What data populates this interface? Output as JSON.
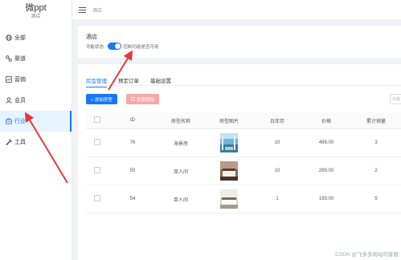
{
  "sidebar": {
    "title": "微ppt",
    "subtitle": "酒店",
    "items": [
      {
        "label": "全部",
        "icon": "globe-icon"
      },
      {
        "label": "渠道",
        "icon": "channel-icon"
      },
      {
        "label": "营销",
        "icon": "chart-icon"
      },
      {
        "label": "会员",
        "icon": "user-icon"
      },
      {
        "label": "行业",
        "icon": "briefcase-icon",
        "active": true
      },
      {
        "label": "工具",
        "icon": "tool-icon"
      }
    ]
  },
  "header": {
    "breadcrumb": "酒店"
  },
  "feature": {
    "title": "酒店",
    "status_label": "功能状态:",
    "status_desc": "控制功能是否可用",
    "enabled": true
  },
  "tabs": [
    "房型管理",
    "预定订单",
    "基础设置"
  ],
  "toolbar": {
    "add_label": "+ 添加房型",
    "delete_label": "批量删除",
    "search_placeholder": "关键"
  },
  "table": {
    "headers": [
      "",
      "ID",
      "房型名称",
      "房型图片",
      "日库存",
      "价格",
      "累计销量"
    ],
    "rows": [
      {
        "id": "76",
        "name": "海景房",
        "image": "sea-view-room-photo",
        "stock": "10",
        "price": "499.00",
        "sales": "3"
      },
      {
        "id": "55",
        "name": "双人间",
        "image": "double-room-photo",
        "stock": "10",
        "price": "299.00",
        "sales": "2"
      },
      {
        "id": "54",
        "name": "单人间",
        "image": "single-room-photo",
        "stock": "1",
        "price": "199.00",
        "sales": "5"
      }
    ]
  },
  "watermark": "CSDN @飞多多网站的客服",
  "colors": {
    "accent": "#1677ff",
    "danger_light": "#f7a7a7",
    "annotation_arrow": "#e53935"
  }
}
